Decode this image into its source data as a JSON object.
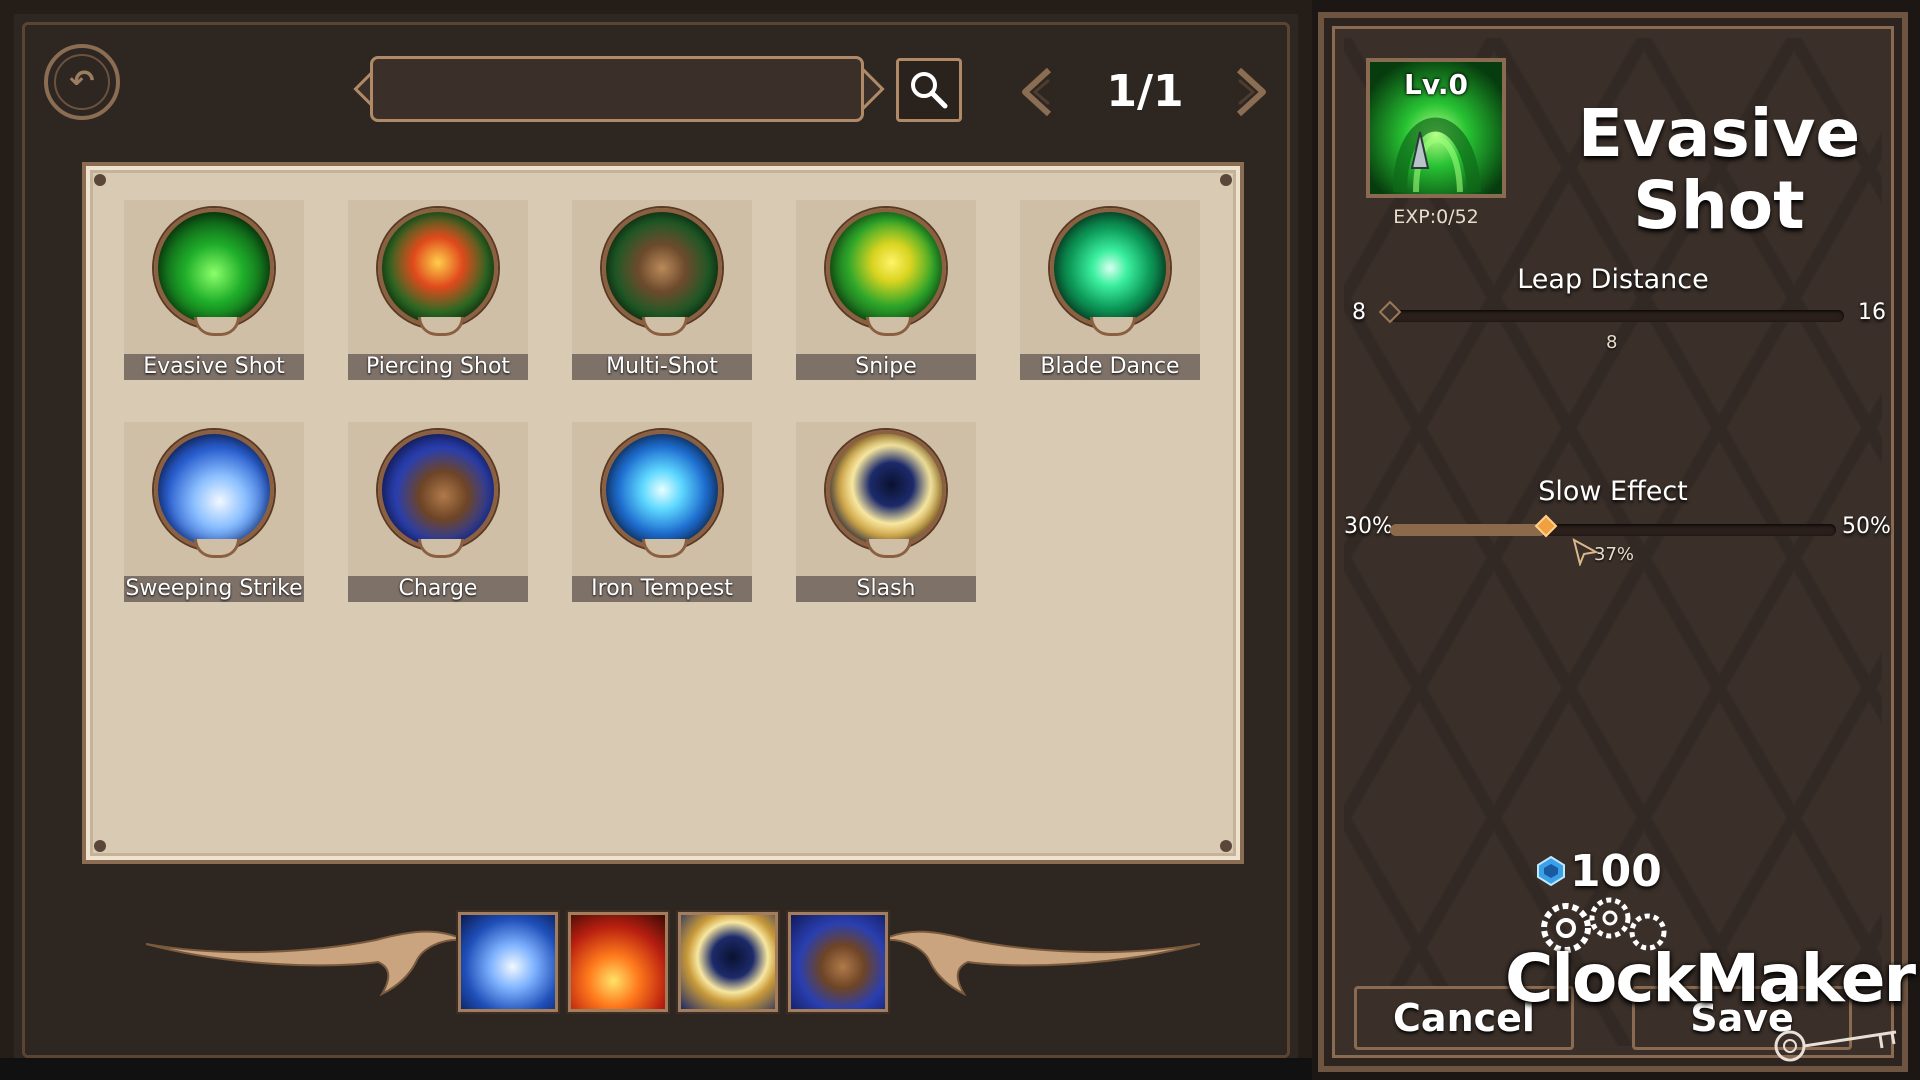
{
  "header": {
    "search_placeholder": "",
    "page_indicator": "1/1"
  },
  "skills": [
    {
      "name": "Evasive Shot"
    },
    {
      "name": "Piercing Shot"
    },
    {
      "name": "Multi-Shot"
    },
    {
      "name": "Snipe"
    },
    {
      "name": "Blade Dance"
    },
    {
      "name": "Sweeping Strike"
    },
    {
      "name": "Charge"
    },
    {
      "name": "Iron Tempest"
    },
    {
      "name": "Slash"
    }
  ],
  "equipped_skills": [
    "Sweeping Strike",
    "fire-skill",
    "Slash",
    "Charge"
  ],
  "detail": {
    "level": "Lv.0",
    "exp": "EXP:0/52",
    "title": "Evasive Shot",
    "leap_distance": {
      "label": "Leap Distance",
      "min": "8",
      "max": "16",
      "value": "8",
      "fraction": 0
    },
    "slow_effect": {
      "label": "Slow Effect",
      "min": "30%",
      "max": "50%",
      "value": "37%",
      "fraction": 0.35
    },
    "cost": "100"
  },
  "buttons": {
    "cancel": "Cancel",
    "save": "Save"
  },
  "watermark": "ClockMaker",
  "colors": {
    "accent": "#b08a66",
    "panel": "#3a2f29",
    "board": "#d9cab3"
  }
}
